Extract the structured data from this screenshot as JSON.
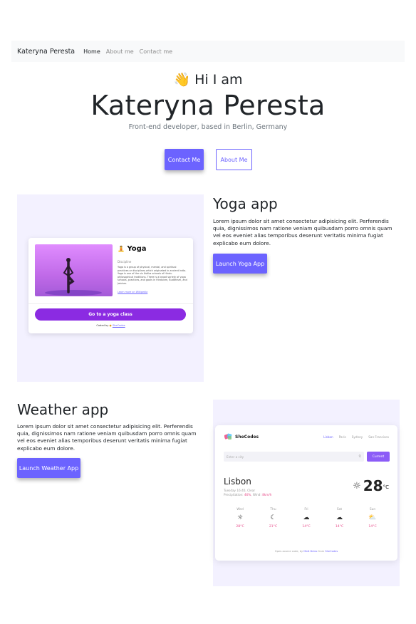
{
  "navbar": {
    "brand": "Kateryna Peresta",
    "links": [
      "Home",
      "About me",
      "Contact me"
    ]
  },
  "hero": {
    "wave_emoji": "👋",
    "greeting": "Hi I am",
    "name": "Kateryna Peresta",
    "subtitle": "Front-end developer, based in Berlin, Germany",
    "contact_button": "Contact Me",
    "about_button": "About Me"
  },
  "projects": {
    "yoga": {
      "title": "Yoga app",
      "description": "Lorem ipsum dolor sit amet consectetur adipisicing elit. Perferendis quia, dignissimos nam ratione veniam quibusdam porro omnis quam vel eos eveniet alias temporibus deserunt veritatis minima fugiat explicabo eum dolore.",
      "launch_button": "Launch Yoga App",
      "preview": {
        "title": "Yoga",
        "title_emoji": "🧘",
        "discipline": "Discipline",
        "text": "Yoga is a group of physical, mental, and spiritual practices or disciplines which originated in ancient India. Yoga is one of the six Âstika schools of Hindu philosophical traditions. There is a broad variety of yoga schools, practices, and goals in Hinduism, Buddhism, and Jainism.",
        "link": "Learn more on Wikipedia",
        "cta": "Go to a yoga class",
        "coded_by": "Coded by",
        "coded_link": "SheCodes"
      }
    },
    "weather": {
      "title": "Weather app",
      "description": "Lorem ipsum dolor sit amet consectetur adipisicing elit. Perferendis quia, dignissimos nam ratione veniam quibusdam porro omnis quam vel eos eveniet alias temporibus deserunt veritatis minima fugiat explicabo eum dolore.",
      "launch_button": "Launch Weather App",
      "preview": {
        "logo": "SheCodes",
        "cities": [
          "Lisbon",
          "Paris",
          "Sydney",
          "San Francisco"
        ],
        "search_placeholder": "Enter a city",
        "current_button": "Current",
        "city": "Lisbon",
        "date_line": "Tuesday 16:40, Clear",
        "precip_label": "Precipitation:",
        "precip_value": "46%",
        "wind_label": "Wind:",
        "wind_value": "8km/h",
        "temperature": "28",
        "unit": "°C",
        "forecast": [
          {
            "day": "Wed",
            "icon": "sun-icon",
            "glyph": "☼",
            "temp": "28°C"
          },
          {
            "day": "Thu",
            "icon": "moon-icon",
            "glyph": "☾",
            "temp": "21°C"
          },
          {
            "day": "Fri",
            "icon": "cloud-icon",
            "glyph": "☁",
            "temp": "14°C"
          },
          {
            "day": "Sat",
            "icon": "cloud-icon",
            "glyph": "☁",
            "temp": "14°C"
          },
          {
            "day": "Sun",
            "icon": "partly-cloudy-icon",
            "glyph": "⛅",
            "temp": "14°C"
          }
        ],
        "footer_a": "Open-source code, by",
        "footer_author": "Matt Delac",
        "footer_b": "from",
        "footer_org": "SheCodes"
      }
    }
  },
  "colors": {
    "accent": "#6c63ff",
    "preview_bg": "#f3f1ff",
    "yoga_cta": "#8b2be2"
  }
}
